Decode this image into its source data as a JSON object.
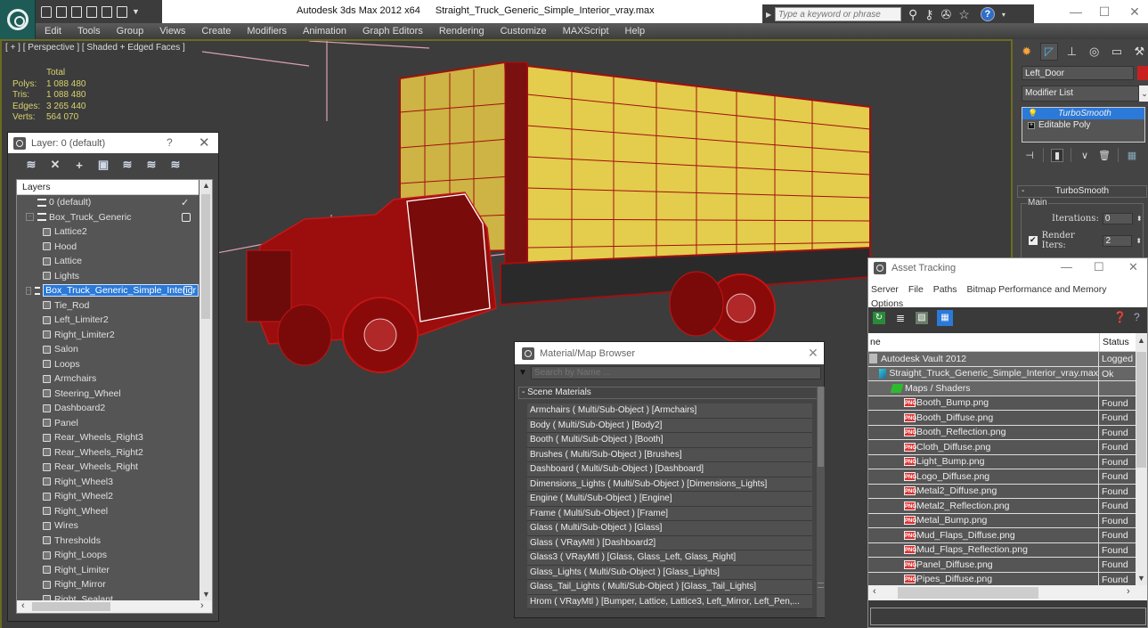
{
  "app": {
    "title": "Autodesk 3ds Max  2012 x64",
    "file_name": "Straight_Truck_Generic_Simple_Interior_vray.max",
    "quick_access": [
      "open-icon",
      "save-icon",
      "new-icon",
      "hold-icon",
      "fetch-icon",
      "project-icon"
    ],
    "search_placeholder": "Type a keyword or phrase",
    "infocenter_icons": [
      "binoculars-icon",
      "key-icon",
      "satellite-icon",
      "star-icon"
    ],
    "help_label": "?",
    "window_controls": {
      "minimize": "—",
      "maximize": "☐",
      "close": "✕"
    }
  },
  "menu": [
    "Edit",
    "Tools",
    "Group",
    "Views",
    "Create",
    "Modifiers",
    "Animation",
    "Graph Editors",
    "Rendering",
    "Customize",
    "MAXScript",
    "Help"
  ],
  "viewport": {
    "label": "[ + ] [ Perspective ] [ Shaded + Edged Faces ]",
    "stats_header": "Total",
    "stats": [
      {
        "label": "Polys:",
        "value": "1 088 480"
      },
      {
        "label": "Tris:",
        "value": "1 088 480"
      },
      {
        "label": "Edges:",
        "value": "3 265 440"
      },
      {
        "label": "Verts:",
        "value": "564 070"
      }
    ],
    "colors": {
      "truck_body": "#e0c84a",
      "wireframe": "#b01010",
      "background": "#3c3c3c"
    }
  },
  "layer_panel": {
    "title": "Layer: 0 (default)",
    "help": "?",
    "close": "✕",
    "toolbar": [
      "create-layer-icon",
      "delete-layer-icon",
      "add-to-layer-icon",
      "select-objects-icon",
      "highlight-layer-icon",
      "hide-all-icon",
      "freeze-all-icon"
    ],
    "header": "Layers",
    "rows": [
      {
        "name": "0 (default)",
        "level": 0,
        "type": "layer",
        "expandable": false,
        "state": "check"
      },
      {
        "name": "Box_Truck_Generic",
        "level": 0,
        "type": "layer",
        "expandable": true,
        "state": "box"
      },
      {
        "name": "Lattice2",
        "level": 1,
        "type": "object"
      },
      {
        "name": "Hood",
        "level": 1,
        "type": "object"
      },
      {
        "name": "Lattice",
        "level": 1,
        "type": "object"
      },
      {
        "name": "Lights",
        "level": 1,
        "type": "object"
      },
      {
        "name": "Box_Truck_Generic_Simple_Interior",
        "level": 0,
        "type": "layer",
        "expandable": true,
        "state": "box",
        "selected": true
      },
      {
        "name": "Tie_Rod",
        "level": 1,
        "type": "object"
      },
      {
        "name": "Left_Limiter2",
        "level": 1,
        "type": "object"
      },
      {
        "name": "Right_Limiter2",
        "level": 1,
        "type": "object"
      },
      {
        "name": "Salon",
        "level": 1,
        "type": "object"
      },
      {
        "name": "Loops",
        "level": 1,
        "type": "object"
      },
      {
        "name": "Armchairs",
        "level": 1,
        "type": "object"
      },
      {
        "name": "Steering_Wheel",
        "level": 1,
        "type": "object"
      },
      {
        "name": "Dashboard2",
        "level": 1,
        "type": "object"
      },
      {
        "name": "Panel",
        "level": 1,
        "type": "object"
      },
      {
        "name": "Rear_Wheels_Right3",
        "level": 1,
        "type": "object"
      },
      {
        "name": "Rear_Wheels_Right2",
        "level": 1,
        "type": "object"
      },
      {
        "name": "Rear_Wheels_Right",
        "level": 1,
        "type": "object"
      },
      {
        "name": "Right_Wheel3",
        "level": 1,
        "type": "object"
      },
      {
        "name": "Right_Wheel2",
        "level": 1,
        "type": "object"
      },
      {
        "name": "Right_Wheel",
        "level": 1,
        "type": "object"
      },
      {
        "name": "Wires",
        "level": 1,
        "type": "object"
      },
      {
        "name": "Thresholds",
        "level": 1,
        "type": "object"
      },
      {
        "name": "Right_Loops",
        "level": 1,
        "type": "object"
      },
      {
        "name": "Right_Limiter",
        "level": 1,
        "type": "object"
      },
      {
        "name": "Right_Mirror",
        "level": 1,
        "type": "object"
      },
      {
        "name": "Right_Sealant",
        "level": 1,
        "type": "object"
      }
    ]
  },
  "command_panel": {
    "tabs": [
      "create-icon",
      "modify-icon",
      "hierarchy-icon",
      "motion-icon",
      "display-icon",
      "utilities-icon"
    ],
    "object_name": "Left_Door",
    "object_color": "#c8201f",
    "modifier_list": "Modifier List",
    "stack": [
      {
        "name": "TurboSmooth",
        "active": true
      },
      {
        "name": "Editable Poly",
        "active": false
      }
    ],
    "rollout": {
      "title": "TurboSmooth",
      "group": "Main",
      "iterations_label": "Iterations:",
      "iterations": "0",
      "render_iters_label": "Render Iters:",
      "render_iters": "2",
      "render_iters_checked": true
    }
  },
  "asset_tracking": {
    "title": "Asset Tracking",
    "menu": [
      "Server",
      "File",
      "Paths",
      "Bitmap Performance and Memory",
      "Options"
    ],
    "columns": {
      "name": "ne",
      "status": "Status"
    },
    "rows": [
      {
        "name": "Autodesk Vault 2012",
        "status": "Logged",
        "icon": "vault",
        "indent": 0
      },
      {
        "name": "Straight_Truck_Generic_Simple_Interior_vray.max",
        "status": "Ok",
        "icon": "max",
        "indent": 1
      },
      {
        "name": "Maps / Shaders",
        "status": "",
        "icon": "maps",
        "indent": 2
      },
      {
        "name": "Booth_Bump.png",
        "status": "Found",
        "icon": "png",
        "indent": 3
      },
      {
        "name": "Booth_Diffuse.png",
        "status": "Found",
        "icon": "png",
        "indent": 3
      },
      {
        "name": "Booth_Reflection.png",
        "status": "Found",
        "icon": "png",
        "indent": 3
      },
      {
        "name": "Cloth_Diffuse.png",
        "status": "Found",
        "icon": "png",
        "indent": 3
      },
      {
        "name": "Light_Bump.png",
        "status": "Found",
        "icon": "png",
        "indent": 3
      },
      {
        "name": "Logo_Diffuse.png",
        "status": "Found",
        "icon": "png",
        "indent": 3
      },
      {
        "name": "Metal2_Diffuse.png",
        "status": "Found",
        "icon": "png",
        "indent": 3
      },
      {
        "name": "Metal2_Reflection.png",
        "status": "Found",
        "icon": "png",
        "indent": 3
      },
      {
        "name": "Metal_Bump.png",
        "status": "Found",
        "icon": "png",
        "indent": 3
      },
      {
        "name": "Mud_Flaps_Diffuse.png",
        "status": "Found",
        "icon": "png",
        "indent": 3
      },
      {
        "name": "Mud_Flaps_Reflection.png",
        "status": "Found",
        "icon": "png",
        "indent": 3
      },
      {
        "name": "Panel_Diffuse.png",
        "status": "Found",
        "icon": "png",
        "indent": 3
      },
      {
        "name": "Pipes_Diffuse.png",
        "status": "Found",
        "icon": "png",
        "indent": 3
      }
    ]
  },
  "material_browser": {
    "title": "Material/Map Browser",
    "close": "✕",
    "search_placeholder": "Search by Name ...",
    "group": "- Scene Materials",
    "items": [
      "Armchairs  ( Multi/Sub-Object ) [Armchairs]",
      "Body  ( Multi/Sub-Object ) [Body2]",
      "Booth  ( Multi/Sub-Object ) [Booth]",
      "Brushes  ( Multi/Sub-Object ) [Brushes]",
      "Dashboard  ( Multi/Sub-Object ) [Dashboard]",
      "Dimensions_Lights  ( Multi/Sub-Object ) [Dimensions_Lights]",
      "Engine  ( Multi/Sub-Object ) [Engine]",
      "Frame  ( Multi/Sub-Object ) [Frame]",
      "Glass  ( Multi/Sub-Object ) [Glass]",
      "Glass  ( VRayMtl ) [Dashboard2]",
      "Glass3  ( VRayMtl ) [Glass, Glass_Left, Glass_Right]",
      "Glass_Lights  ( Multi/Sub-Object ) [Glass_Lights]",
      "Glass_Tail_Lights  ( Multi/Sub-Object ) [Glass_Tail_Lights]",
      "Hrom  ( VRayMtl ) [Bumper, Lattice, Lattice3, Left_Mirror, Left_Pen,..."
    ]
  }
}
